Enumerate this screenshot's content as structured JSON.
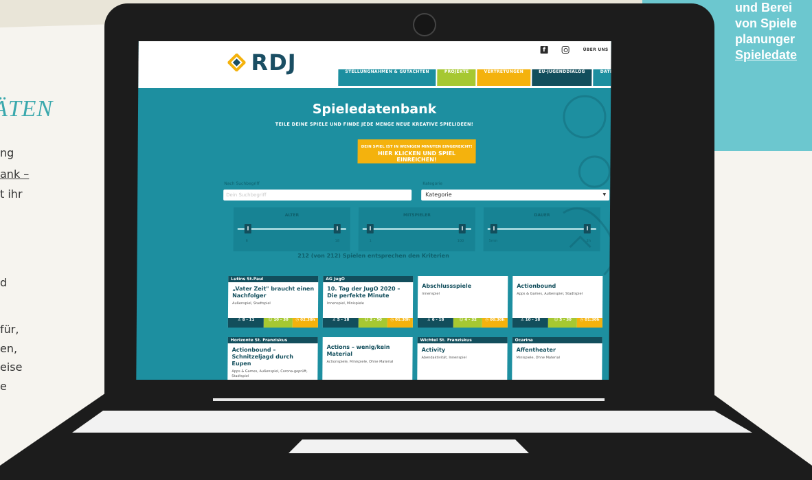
{
  "background": {
    "side_lines": [
      "und Berei",
      "von Spiele",
      "planunger",
      "Spieledate"
    ],
    "left_heading": "ÄTEN",
    "left_lines": [
      "ng",
      "ank –",
      "t ihr",
      "d",
      "für,",
      "en,",
      "eise",
      "e"
    ]
  },
  "site": {
    "logo_text": "RDJ",
    "top_links": {
      "about": "ÜBER UNS",
      "facebook": "f"
    },
    "nav": [
      {
        "label": "STELLUNGNAHMEN & GUTACHTEN",
        "color": "#1d8fa0"
      },
      {
        "label": "PROJEKTE",
        "color": "#a6c832"
      },
      {
        "label": "VERTRETUNGEN",
        "color": "#f4b20d"
      },
      {
        "label": "EU-JUGENDDIALOG",
        "color": "#124e5c"
      },
      {
        "label": "DATENBANKEN",
        "color": "#1d8fa0"
      }
    ],
    "title": "Spieledatenbank",
    "subtitle": "TEILE DEINE SPIELE UND FINDE JEDE MENGE NEUE KREATIVE SPIELIDEEN!",
    "cta": {
      "line1": "DEIN SPIEL IST IN WENIGEN MINUTEN EINGEREICHT!",
      "line2": "HIER KLICKEN UND SPIEL EINREICHEN!"
    },
    "filters": {
      "search_label": "Nach Suchbegriff",
      "search_placeholder": "Dein Suchbegriff",
      "category_label": "Kategorie",
      "category_value": "Kategorie"
    },
    "sliders": [
      {
        "label": "ALTER",
        "min": "6",
        "max": "18",
        "range": [
          6,
          18
        ]
      },
      {
        "label": "MITSPIELER",
        "min": "1",
        "max": "100",
        "range": [
          1,
          100
        ]
      },
      {
        "label": "DAUER",
        "min": "5min",
        "max": "2h",
        "range": [
          5,
          120
        ]
      }
    ],
    "results_text": "212 (von 212) Spielen entsprechen den Kriterien",
    "cards": [
      {
        "org": "Lutins St.Paul",
        "title": "„Vater Zeit\" braucht einen Nachfolger",
        "tags": "Außenspiel, Stadtspiel",
        "age": "8 - 11",
        "players": "10 - 30",
        "duration": "02:30h"
      },
      {
        "org": "AG JugO",
        "title": "10. Tag der JugO 2020 – Die perfekte Minute",
        "tags": "Innenspiel, Minispiele",
        "age": "5 - 18",
        "players": "2 - 50",
        "duration": "01:30h"
      },
      {
        "org": "",
        "title": "Abschlussspiele",
        "tags": "Innenspiel",
        "age": "6 - 18",
        "players": "4 - 32",
        "duration": "00:30h"
      },
      {
        "org": "",
        "title": "Actionbound",
        "tags": "Apps & Games, Außenspiel, Stadtspiel",
        "age": "10 - 18",
        "players": "5 - 30",
        "duration": "01:30h"
      },
      {
        "org": "Horizonte St. Franziskus",
        "title": "Actionbound – Schnitzeljagd durch Eupen",
        "tags": "Apps & Games, Außenspiel, Corona-geprüft, Stadtspiel",
        "age": "",
        "players": "",
        "duration": ""
      },
      {
        "org": "",
        "title": "Actions – wenig/kein Material",
        "tags": "Actionspiele, Minispiele, Ohne Material",
        "age": "",
        "players": "",
        "duration": ""
      },
      {
        "org": "Wichtel St. Franziskus",
        "title": "Activity",
        "tags": "Abendaktivität, Innenspiel",
        "age": "",
        "players": "",
        "duration": ""
      },
      {
        "org": "Ocarina",
        "title": "Affentheater",
        "tags": "Minispiele, Ohne Material",
        "age": "",
        "players": "",
        "duration": ""
      }
    ]
  }
}
